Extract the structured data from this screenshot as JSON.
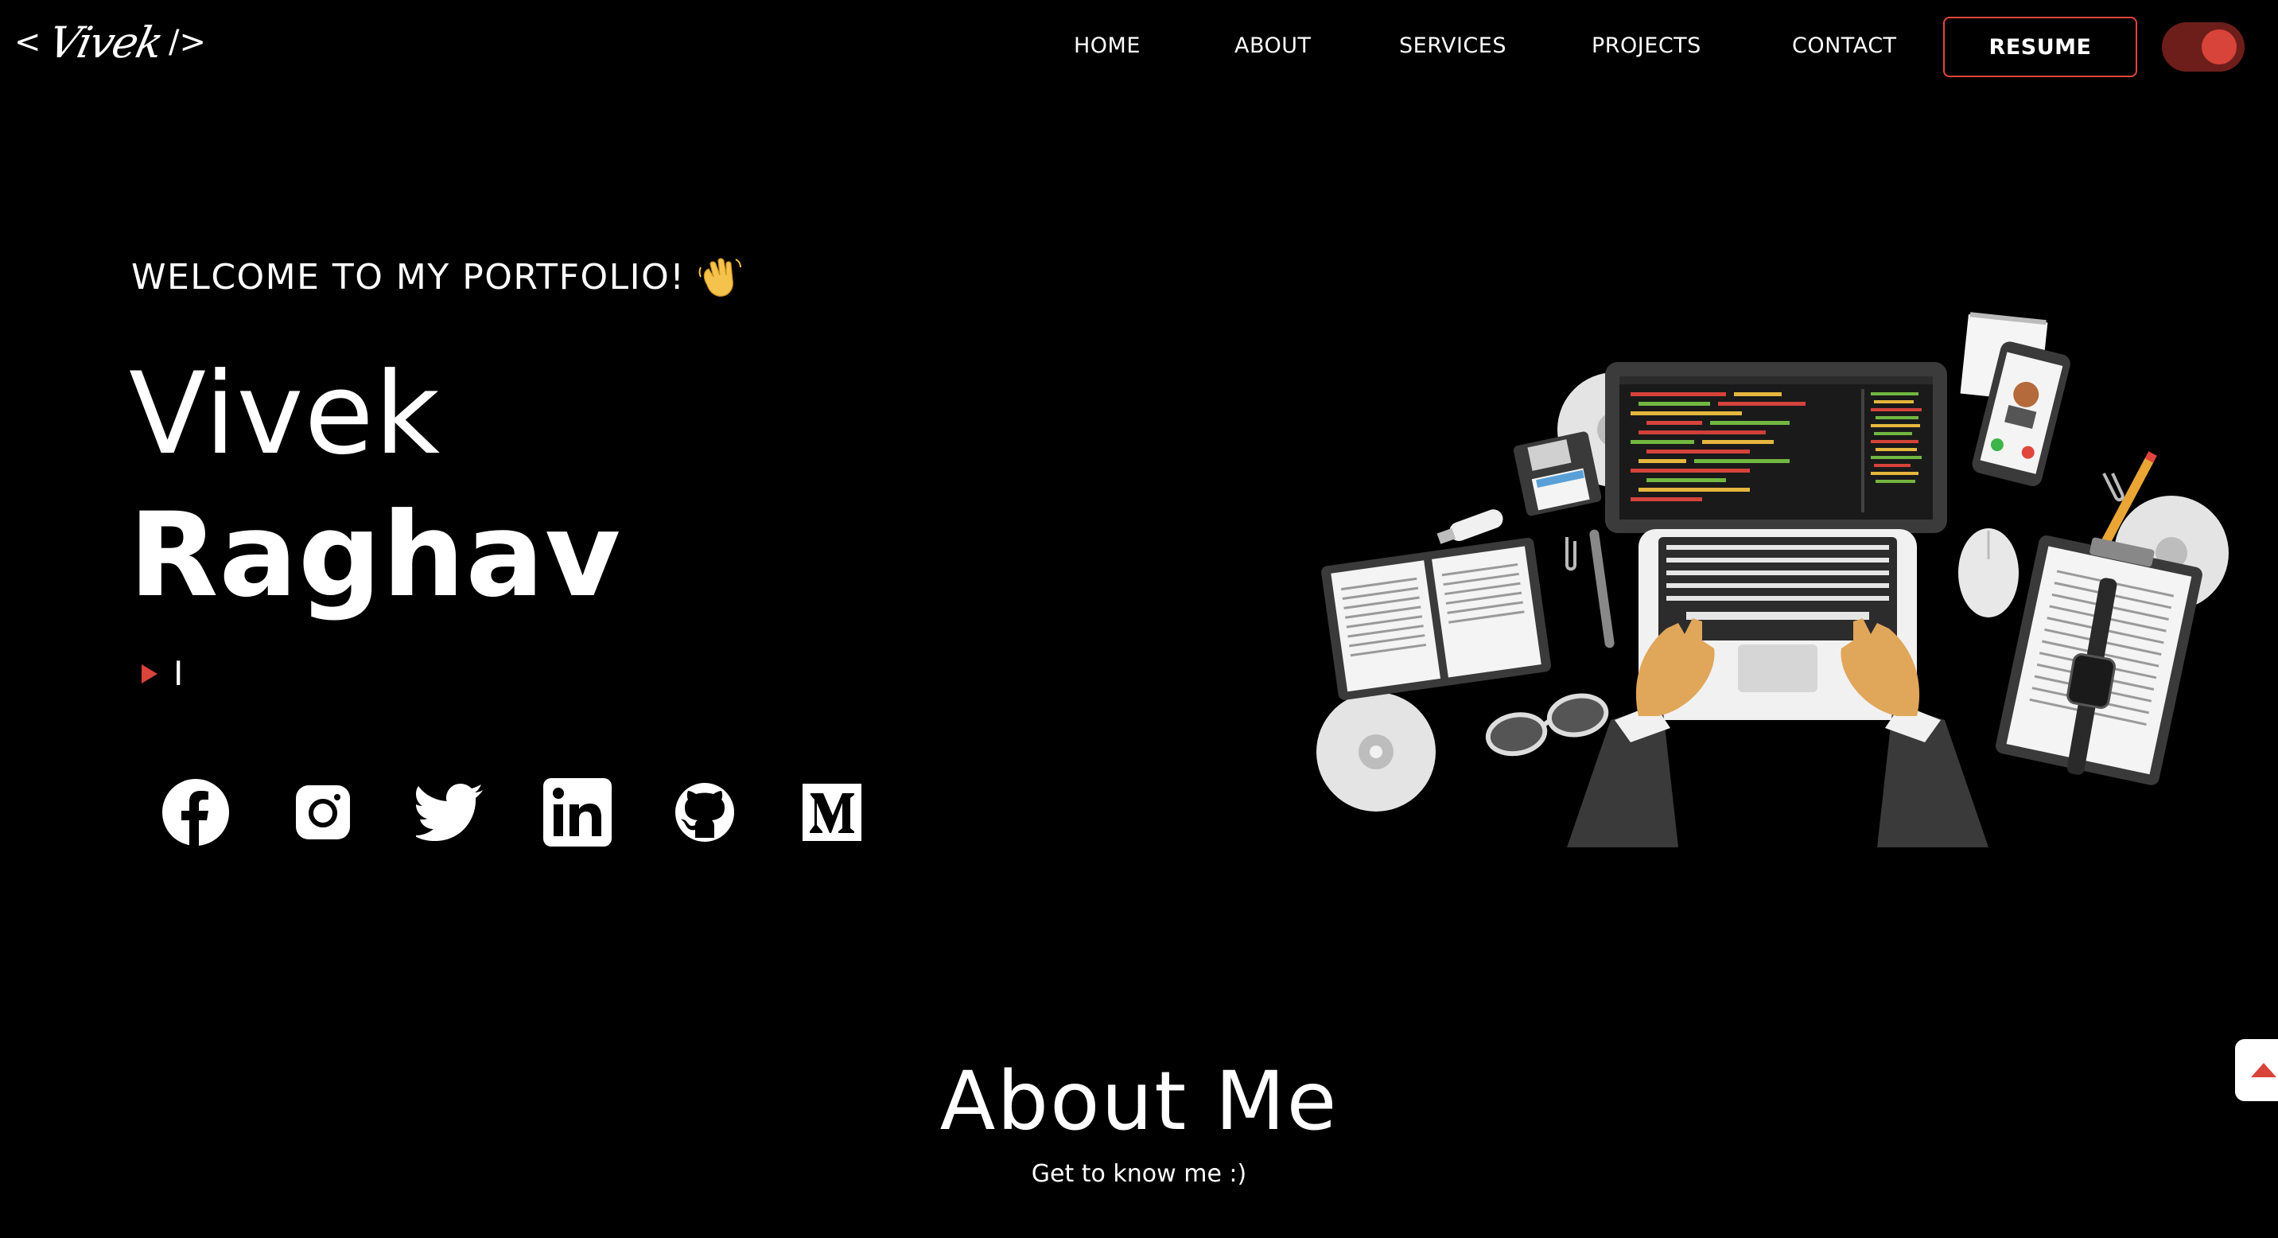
{
  "header": {
    "logo": {
      "open_bracket": "<",
      "signature": "Vivek",
      "close_bracket": "/>"
    },
    "nav": [
      {
        "label": "HOME"
      },
      {
        "label": "ABOUT"
      },
      {
        "label": "SERVICES"
      },
      {
        "label": "PROJECTS"
      },
      {
        "label": "CONTACT"
      }
    ],
    "resume_label": "RESUME",
    "theme_toggle": {
      "state": "dark"
    }
  },
  "hero": {
    "welcome": "WELCOME TO MY PORTFOLIO!",
    "welcome_icon": "waving-hand-icon",
    "first_name": "Vivek",
    "last_name": "Raghav",
    "typed_text": "I",
    "socials": [
      {
        "icon": "facebook-icon"
      },
      {
        "icon": "instagram-icon"
      },
      {
        "icon": "twitter-icon"
      },
      {
        "icon": "linkedin-icon"
      },
      {
        "icon": "github-icon"
      },
      {
        "icon": "medium-icon"
      }
    ]
  },
  "about": {
    "title": "About Me",
    "subtitle": "Get to know me :)"
  },
  "colors": {
    "background": "#000000",
    "accent": "#d8433a",
    "text": "#ffffff"
  }
}
